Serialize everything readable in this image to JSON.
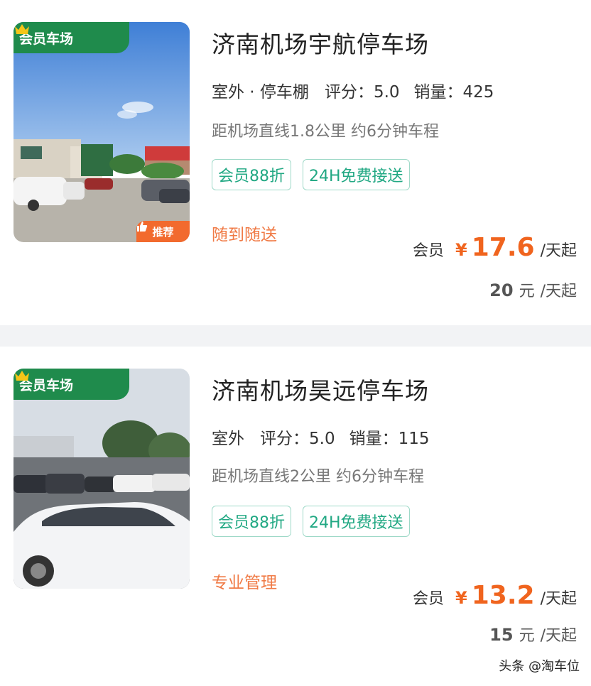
{
  "listings": [
    {
      "member_badge": "会员车场",
      "recommend_badge": "推荐",
      "title": "济南机场宇航停车场",
      "type": "室外 · 停车棚",
      "rating": "评分：5.0",
      "sales": "销量：425",
      "distance": "距机场直线1.8公里 约6分钟车程",
      "tags": [
        "会员88折",
        "24H免费接送"
      ],
      "feature": "随到随送",
      "member_label": "会员",
      "currency": "¥",
      "member_price": "17.6",
      "price_unit": "/天起",
      "original_price": "20",
      "original_currency": "元",
      "original_unit": "/天起"
    },
    {
      "member_badge": "会员车场",
      "title": "济南机场昊远停车场",
      "type": "室外",
      "rating": "评分：5.0",
      "sales": "销量：115",
      "distance": "距机场直线2公里 约6分钟车程",
      "tags": [
        "会员88折",
        "24H免费接送"
      ],
      "feature": "专业管理",
      "member_label": "会员",
      "currency": "¥",
      "member_price": "13.2",
      "price_unit": "/天起",
      "original_price": "15",
      "original_currency": "元",
      "original_unit": "/天起"
    }
  ],
  "watermark": "头条 @淘车位",
  "colors": {
    "badge_green": "#1f8b4c",
    "price_orange": "#f0641e",
    "tag_teal": "#21a883",
    "feature_orange": "#f07a45"
  },
  "icons": [
    "crown-icon",
    "thumbs-up-icon"
  ]
}
